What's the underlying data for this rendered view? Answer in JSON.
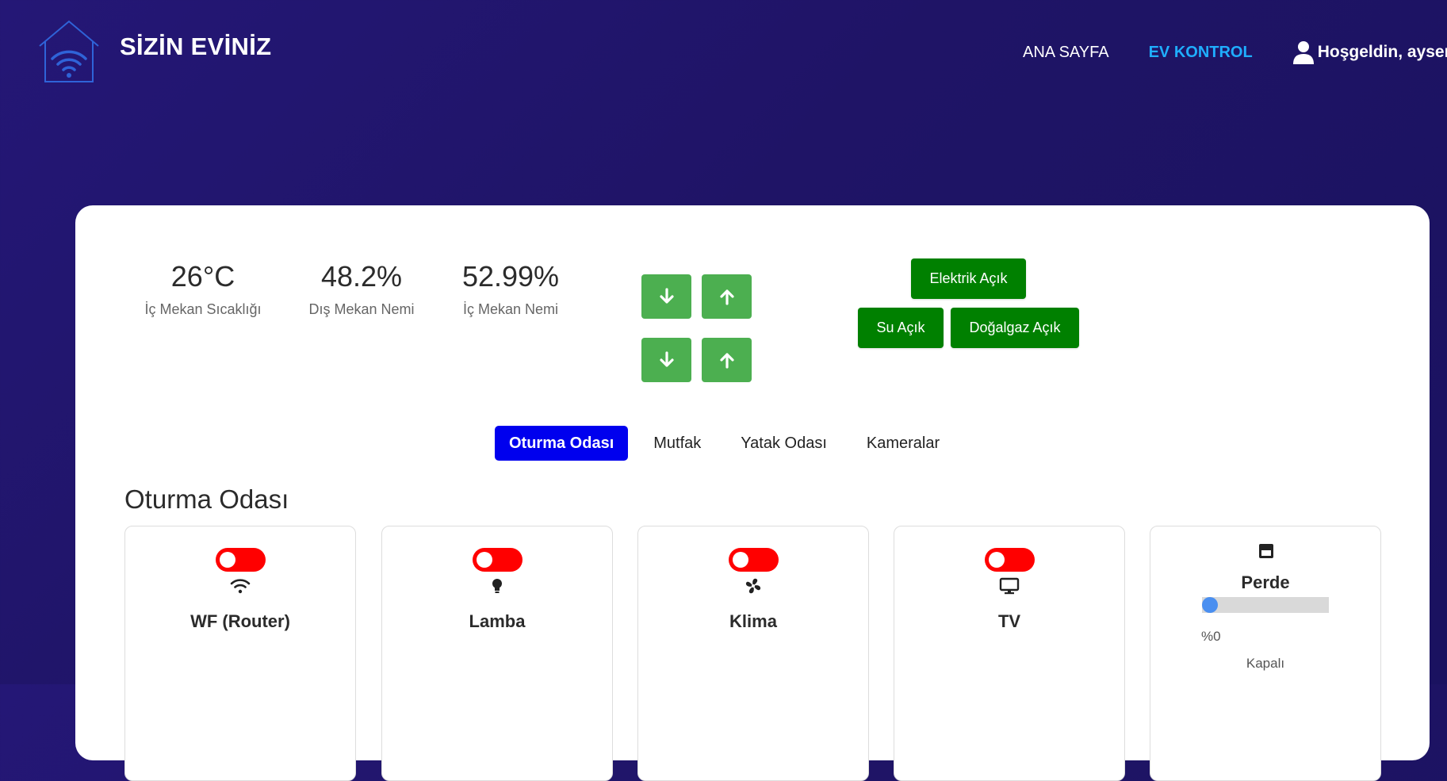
{
  "header": {
    "brand": "SİZİN EVİNİZ",
    "nav": {
      "home": "ANA SAYFA",
      "control": "EV KONTROL",
      "user": "Hoşgeldin, aysen"
    }
  },
  "stats": [
    {
      "value": "26°C",
      "label": "İç Mekan Sıcaklığı"
    },
    {
      "value": "48.2%",
      "label": "Dış Mekan Nemi"
    },
    {
      "value": "52.99%",
      "label": "İç Mekan Nemi"
    }
  ],
  "arrow_icons": [
    "arrow-down-icon",
    "arrow-up-icon"
  ],
  "utilities": {
    "electric": "Elektrik Açık",
    "water": "Su Açık",
    "gas": "Doğalgaz Açık",
    "color": "#008000"
  },
  "tabs": [
    "Oturma Odası",
    "Mutfak",
    "Yatak Odası",
    "Kameralar"
  ],
  "room": {
    "title": "Oturma Odası",
    "devices": [
      {
        "name": "WF (Router)",
        "icon": "wifi-icon",
        "on": false
      },
      {
        "name": "Lamba",
        "icon": "lightbulb-icon",
        "on": false
      },
      {
        "name": "Klima",
        "icon": "fan-icon",
        "on": false
      },
      {
        "name": "TV",
        "icon": "tv-icon",
        "on": false
      }
    ],
    "curtain": {
      "name": "Perde",
      "icon": "window-icon",
      "percent_text": "%0",
      "level": 0,
      "status": "Kapalı"
    }
  },
  "colors": {
    "background": "#1f1466",
    "nav_active": "#1faeff",
    "arrow_button": "#4caf50",
    "tab_active": "#0000ee",
    "toggle_off": "#ff0000",
    "slider_thumb": "#4a8ff0"
  }
}
